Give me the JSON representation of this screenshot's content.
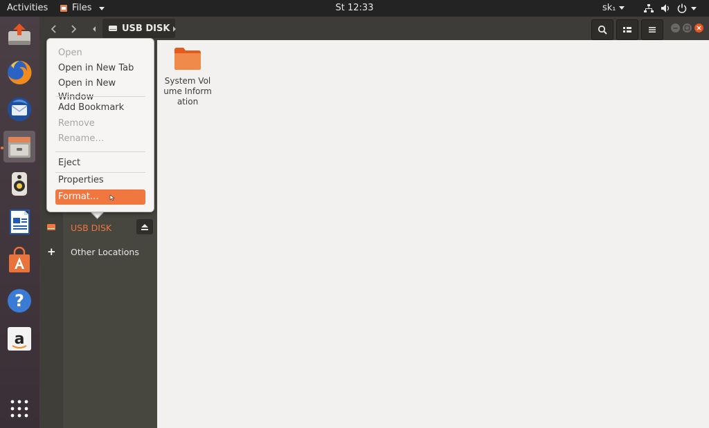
{
  "topbar": {
    "activities": "Activities",
    "app_name": "Files",
    "clock": "St 12:33",
    "user": "sk₁"
  },
  "dock": {
    "items": [
      {
        "name": "Backup"
      },
      {
        "name": "Firefox"
      },
      {
        "name": "Thunderbird"
      },
      {
        "name": "Files"
      },
      {
        "name": "Rhythmbox"
      },
      {
        "name": "LibreOffice Writer"
      },
      {
        "name": "Ubuntu Software"
      },
      {
        "name": "Help"
      },
      {
        "name": "Amazon"
      },
      {
        "name": "Show Applications"
      }
    ]
  },
  "header": {
    "path_label": "USB DISK"
  },
  "sidebar": {
    "usb_label": "USB DISK",
    "other_locations": "Other Locations",
    "plus": "+"
  },
  "content": {
    "folder_label": "System Volume Information"
  },
  "context_menu": {
    "items": [
      {
        "label": "Open",
        "enabled": false
      },
      {
        "label": "Open in New Tab",
        "enabled": true
      },
      {
        "label": "Open in New Window",
        "enabled": true
      },
      {
        "label": "Add Bookmark",
        "enabled": true
      },
      {
        "label": "Remove",
        "enabled": false
      },
      {
        "label": "Rename…",
        "enabled": false
      },
      {
        "label": "Eject",
        "enabled": true
      },
      {
        "label": "Properties",
        "enabled": true
      },
      {
        "label": "Format…",
        "enabled": true,
        "highlighted": true
      }
    ]
  },
  "colors": {
    "accent": "#f0773f",
    "close": "#e95420"
  }
}
